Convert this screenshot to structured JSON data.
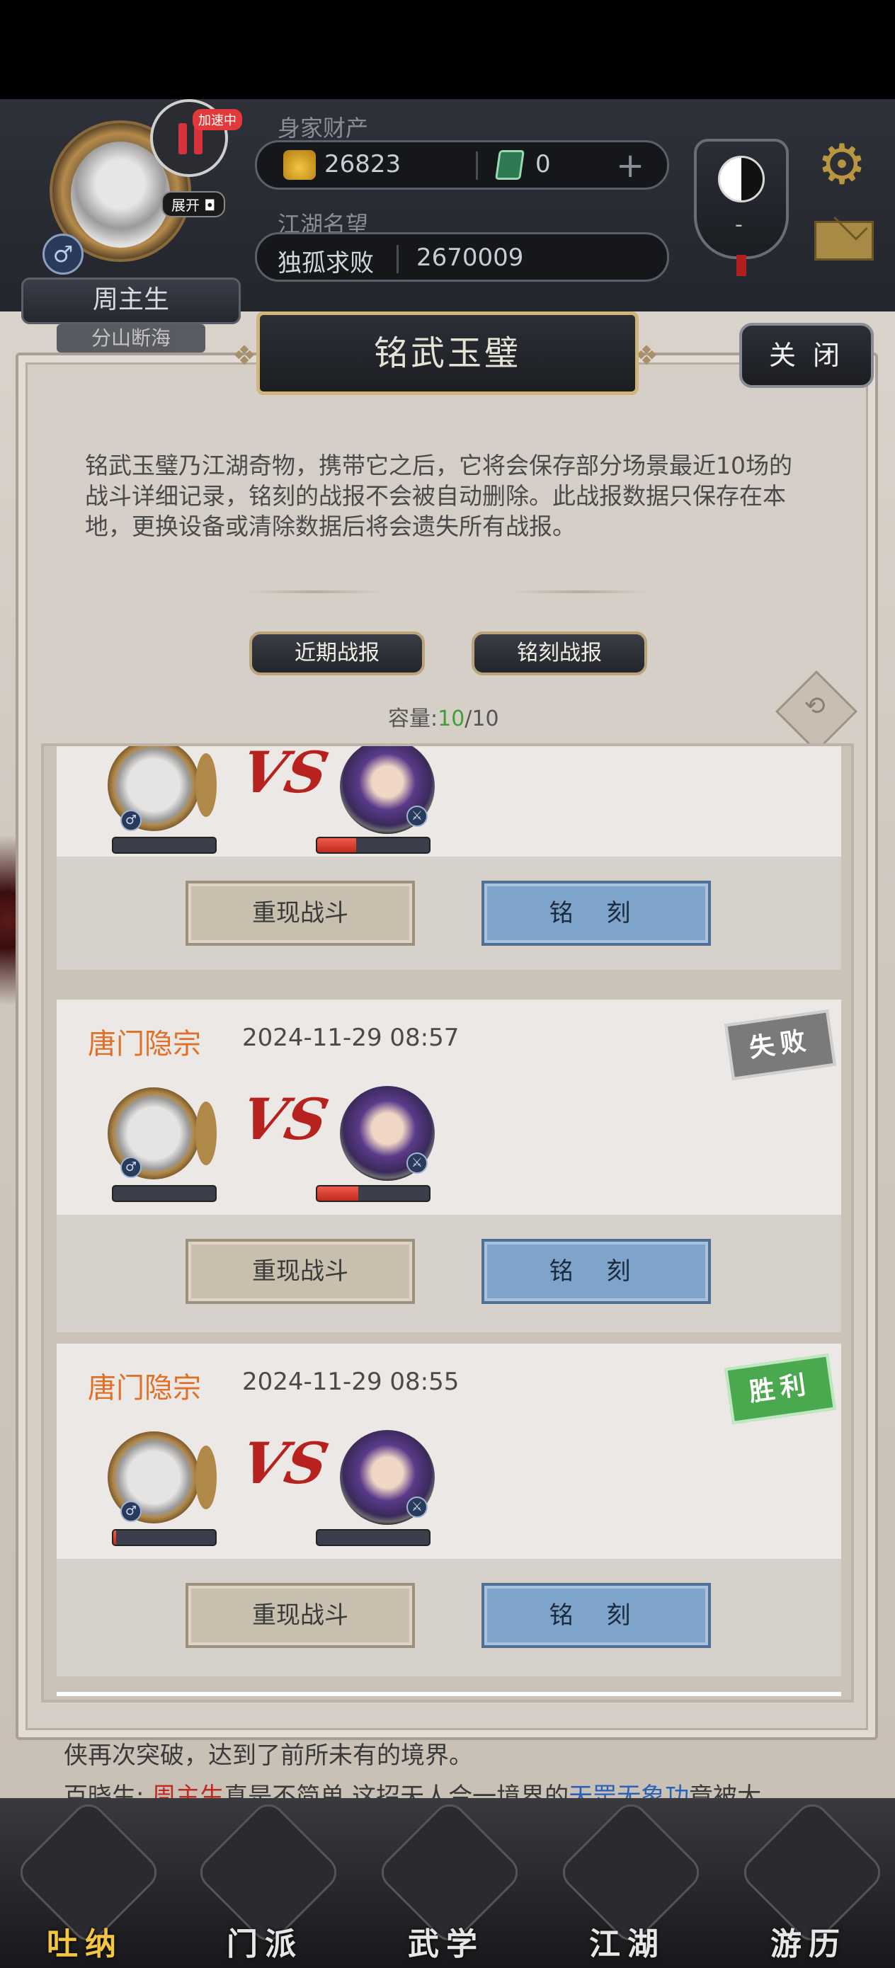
{
  "player": {
    "name": "周主生",
    "title": "分山断海",
    "speed_tag": "加速中",
    "expand_label": "展开",
    "gender": "♂"
  },
  "resources": {
    "wealth_label": "身家财产",
    "gold": "26823",
    "jade": "0",
    "fame_label": "江湖名望",
    "fame_title": "独孤求败",
    "fame_value": "2670009",
    "yinyang_value": "-"
  },
  "dialog": {
    "title": "铭武玉璧",
    "close_label": "关 闭",
    "description": "铭武玉璧乃江湖奇物，携带它之后，它将会保存部分场景最近10场的战斗详细记录，铭刻的战报不会被自动删除。此战报数据只保存在本地，更换设备或清除数据后将会遗失所有战报。",
    "tabs": [
      "近期战报",
      "铭刻战报"
    ],
    "capacity_label": "容量:",
    "capacity_used": "10",
    "capacity_total": "/10"
  },
  "battles": [
    {
      "clan": "",
      "time": "",
      "result": "",
      "hero_hp": 0.0,
      "enemy_hp": 0.35,
      "replay_label": "重现战斗",
      "engrave_label": "铭 刻"
    },
    {
      "clan": "唐门隐宗",
      "time": "2024-11-29 08:57",
      "result": "失败",
      "hero_hp": 0.0,
      "enemy_hp": 0.37,
      "replay_label": "重现战斗",
      "engrave_label": "铭 刻"
    },
    {
      "clan": "唐门隐宗",
      "time": "2024-11-29 08:55",
      "result": "胜利",
      "hero_hp": 0.03,
      "enemy_hp": 0.0,
      "replay_label": "重现战斗",
      "engrave_label": "铭 刻"
    }
  ],
  "vs_label": "VS",
  "feed": {
    "line1": "侠再次突破，达到了前所未有的境界。",
    "line2_prefix": "百晓生: ",
    "line2_name": "周主生",
    "line2_mid": "真是不简单,这招天人合一境界的",
    "line2_skill": "天罡无象功",
    "line2_suffix": "竟被大"
  },
  "nav": [
    {
      "label": "吐纳",
      "active": true
    },
    {
      "label": "门派",
      "active": false
    },
    {
      "label": "武学",
      "active": false
    },
    {
      "label": "江湖",
      "active": false
    },
    {
      "label": "游历",
      "active": false
    }
  ],
  "colors": {
    "accent_orange": "#e07028",
    "win_green": "#4aa84e",
    "lose_gray": "#7a7a7a",
    "engrave_blue": "#7fa4cb"
  }
}
